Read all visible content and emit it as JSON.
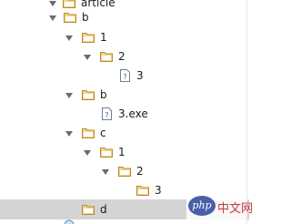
{
  "tree": {
    "rows": [
      {
        "label": "article",
        "type": "folder",
        "expanded": true
      },
      {
        "label": "b",
        "type": "folder",
        "expanded": true
      },
      {
        "label": "1",
        "type": "folder",
        "expanded": true
      },
      {
        "label": "2",
        "type": "folder",
        "expanded": true
      },
      {
        "label": "3",
        "type": "file"
      },
      {
        "label": "b",
        "type": "folder",
        "expanded": true
      },
      {
        "label": "3.exe",
        "type": "file"
      },
      {
        "label": "c",
        "type": "folder",
        "expanded": true
      },
      {
        "label": "1",
        "type": "folder",
        "expanded": true
      },
      {
        "label": "2",
        "type": "folder",
        "expanded": true
      },
      {
        "label": "3",
        "type": "folder"
      },
      {
        "label": "d",
        "type": "folder",
        "selected": true
      }
    ]
  },
  "colors": {
    "folder_fill": "#f3d58a",
    "folder_stroke": "#b88a2a",
    "arrow": "#6b6b6b",
    "selection": "#d4d4d4"
  },
  "watermark": {
    "logo_text": "php",
    "site_text": "中文网"
  }
}
